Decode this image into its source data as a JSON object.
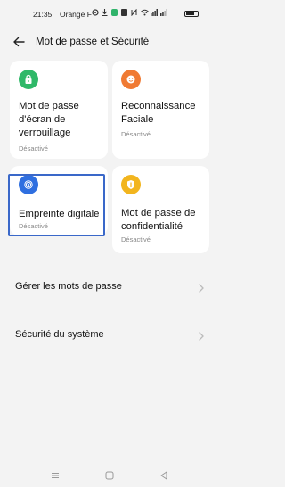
{
  "status": {
    "time": "21:35",
    "carrier": "Orange F"
  },
  "header": {
    "title": "Mot de passe et Sécurité"
  },
  "cards": [
    {
      "label": "Mot de passe d'écran de verrouillage",
      "status": "Désactivé",
      "icon": "lock-icon",
      "color": "#2fb868"
    },
    {
      "label": "Reconnaissance Faciale",
      "status": "Désactivé",
      "icon": "face-icon",
      "color": "#f07a33"
    },
    {
      "label": "Empreinte digitale",
      "status": "Désactivé",
      "icon": "fingerprint-icon",
      "color": "#2f6fe0"
    },
    {
      "label": "Mot de passe de confidentialité",
      "status": "Désactivé",
      "icon": "shield-icon",
      "color": "#f2b51e"
    }
  ],
  "list": [
    {
      "label": "Gérer les mots de passe"
    },
    {
      "label": "Sécurité du système"
    }
  ],
  "colors": {
    "background": "#f3f3f3",
    "highlight": "#3a68c9"
  }
}
